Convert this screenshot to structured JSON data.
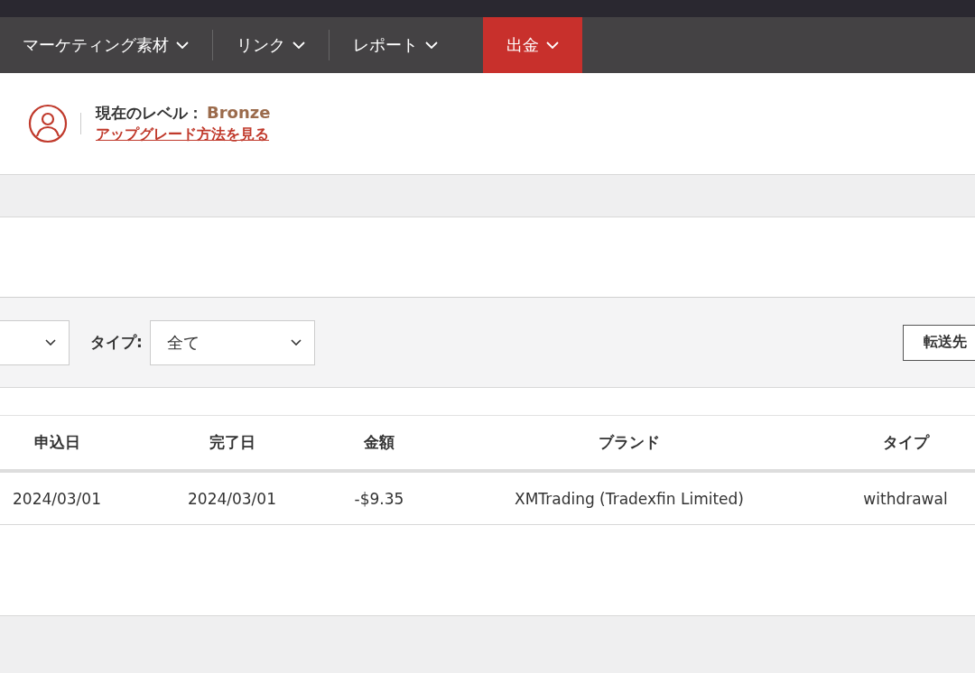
{
  "nav": {
    "items": [
      {
        "label": "マーケティング素材",
        "selected": false
      },
      {
        "label": "リンク",
        "selected": false
      },
      {
        "label": "レポート",
        "selected": false
      },
      {
        "label": "出金",
        "selected": true
      }
    ]
  },
  "level": {
    "label": "現在のレベル：",
    "value": "Bronze",
    "upgrade_link": "アップグレード方法を見る"
  },
  "filters": {
    "type_label": "タイプ:",
    "type_value": "全て",
    "transfer_button": "転送先"
  },
  "table": {
    "columns": [
      "申込日",
      "完了日",
      "金額",
      "ブランド",
      "タイプ"
    ],
    "rows": [
      [
        "2024/03/01",
        "2024/03/01",
        "-$9.35",
        "XMTrading (Tradexfin Limited)",
        "withdrawal"
      ]
    ]
  }
}
